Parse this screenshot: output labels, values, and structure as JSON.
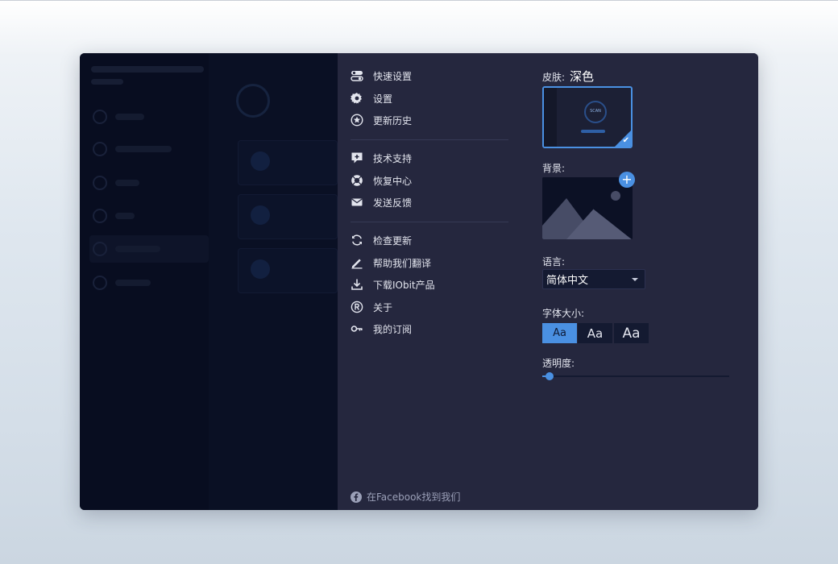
{
  "menu": {
    "items": [
      {
        "label": "快速设置",
        "icon": "toggle-icon"
      },
      {
        "label": "设置",
        "icon": "gear-icon"
      },
      {
        "label": "更新历史",
        "icon": "star-icon"
      },
      {
        "label": "技术支持",
        "icon": "support-icon"
      },
      {
        "label": "恢复中心",
        "icon": "lifebuoy-icon"
      },
      {
        "label": "发送反馈",
        "icon": "mail-icon"
      },
      {
        "label": "检查更新",
        "icon": "refresh-icon"
      },
      {
        "label": "帮助我们翻译",
        "icon": "pencil-icon"
      },
      {
        "label": "下载IObit产品",
        "icon": "download-icon"
      },
      {
        "label": "关于",
        "icon": "registered-icon"
      },
      {
        "label": "我的订阅",
        "icon": "key-icon"
      }
    ],
    "facebook": "在Facebook找到我们"
  },
  "settings": {
    "skin_label": "皮肤:",
    "skin_value": "深色",
    "skin_thumb_text": "SCAN",
    "background_label": "背景:",
    "language_label": "语言:",
    "language_value": "简体中文",
    "font_size_label": "字体大小:",
    "font_options": [
      "Aa",
      "Aa",
      "Aa"
    ],
    "font_selected_index": 0,
    "opacity_label": "透明度:",
    "opacity_level": 0.04
  },
  "colors": {
    "accent": "#4a90e2",
    "panel": "#25273e",
    "backdrop": "#080d20"
  }
}
